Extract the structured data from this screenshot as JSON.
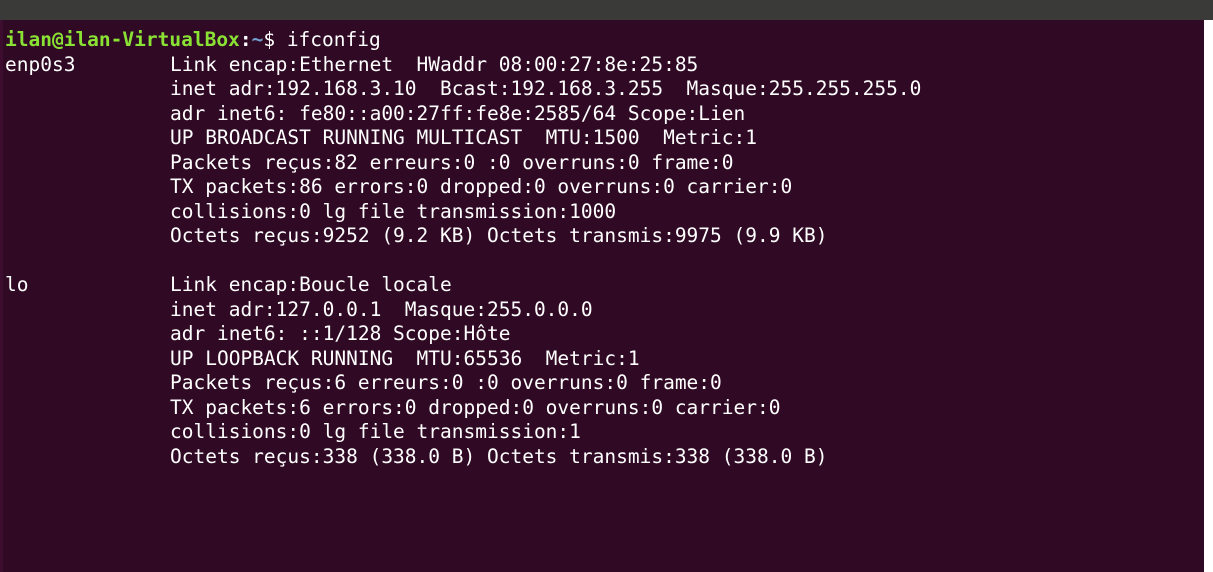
{
  "terminal": {
    "prompt": {
      "user_host": "ilan@ilan-VirtualBox",
      "colon": ":",
      "path": "~",
      "symbol": "$",
      "command": "ifconfig"
    },
    "interfaces": [
      {
        "name": "enp0s3",
        "lines": [
          "Link encap:Ethernet  HWaddr 08:00:27:8e:25:85",
          "inet adr:192.168.3.10  Bcast:192.168.3.255  Masque:255.255.255.0",
          "adr inet6: fe80::a00:27ff:fe8e:2585/64 Scope:Lien",
          "UP BROADCAST RUNNING MULTICAST  MTU:1500  Metric:1",
          "Packets reçus:82 erreurs:0 :0 overruns:0 frame:0",
          "TX packets:86 errors:0 dropped:0 overruns:0 carrier:0",
          "collisions:0 lg file transmission:1000",
          "Octets reçus:9252 (9.2 KB) Octets transmis:9975 (9.9 KB)"
        ]
      },
      {
        "name": "lo",
        "lines": [
          "Link encap:Boucle locale",
          "inet adr:127.0.0.1  Masque:255.0.0.0",
          "adr inet6: ::1/128 Scope:Hôte",
          "UP LOOPBACK RUNNING  MTU:65536  Metric:1",
          "Packets reçus:6 erreurs:0 :0 overruns:0 frame:0",
          "TX packets:6 errors:0 dropped:0 overruns:0 carrier:0",
          "collisions:0 lg file transmission:1",
          "Octets reçus:338 (338.0 B) Octets transmis:338 (338.0 B)"
        ]
      }
    ],
    "colors": {
      "background": "#300a24",
      "prompt_user": "#8ae234",
      "prompt_path": "#729fcf",
      "text": "#ffffff"
    }
  }
}
